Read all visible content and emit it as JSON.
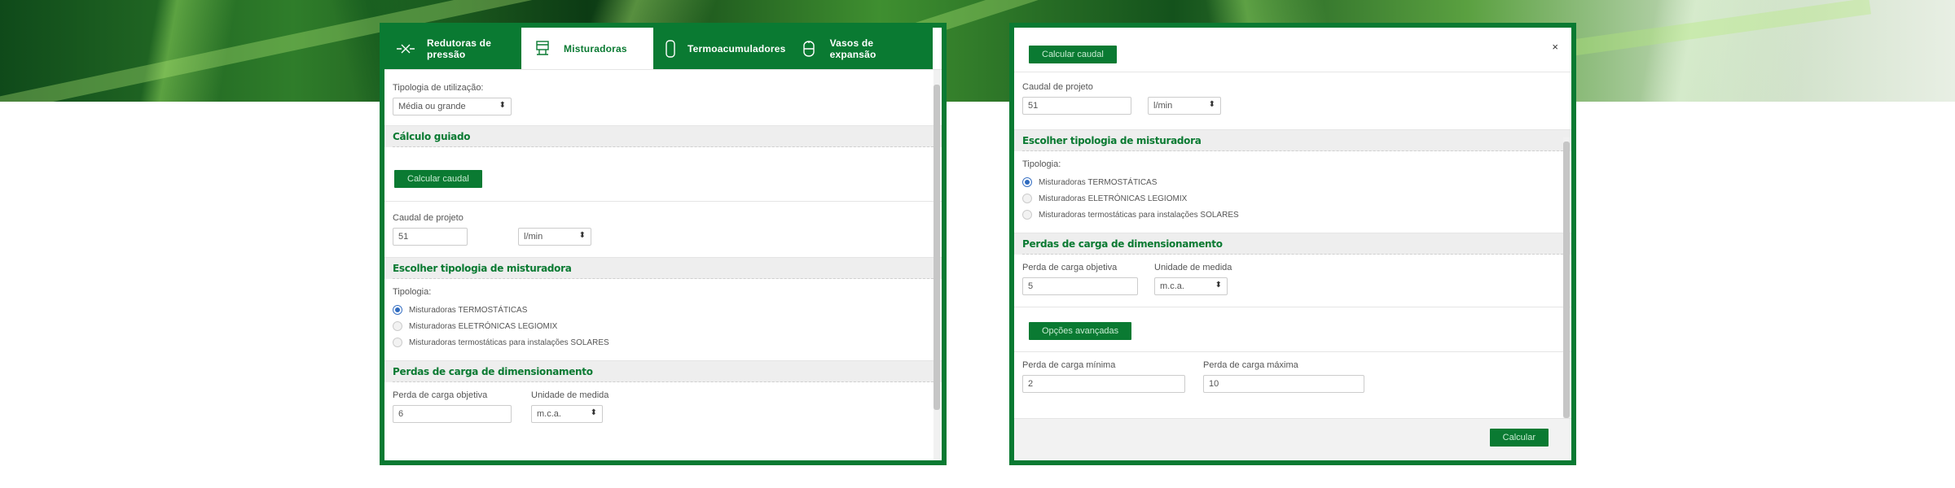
{
  "left_panel": {
    "tabs": [
      {
        "label": "Redutoras de pressão",
        "icon": "pipe-valve-icon"
      },
      {
        "label": "Misturadoras",
        "icon": "mixer-icon"
      },
      {
        "label": "Termoacumuladores",
        "icon": "water-heater-icon"
      },
      {
        "label": "Vasos de expansão",
        "icon": "expansion-vessel-icon"
      }
    ],
    "usage_label": "Tipologia de utilização:",
    "usage_value": "Média ou grande",
    "guided_title": "Cálculo guiado",
    "calc_flow_button": "Calcular caudal",
    "project_flow_label": "Caudal de projeto",
    "project_flow_value": "51",
    "project_flow_unit": "l/min",
    "mixer_title": "Escolher tipologia de misturadora",
    "typology_label": "Tipologia:",
    "options": [
      "Misturadoras TERMOSTÁTICAS",
      "Misturadoras ELETRÓNICAS LEGIOMIX",
      "Misturadoras termostáticas para instalações SOLARES"
    ],
    "losses_title": "Perdas de carga de dimensionamento",
    "target_loss_label": "Perda de carga objetiva",
    "target_loss_value": "6",
    "unit_label": "Unidade de medida",
    "unit_value": "m.c.a."
  },
  "right_panel": {
    "close_glyph": "×",
    "calc_flow_button": "Calcular caudal",
    "project_flow_label": "Caudal de projeto",
    "project_flow_value": "51",
    "project_flow_unit": "l/min",
    "mixer_title": "Escolher tipologia de misturadora",
    "typology_label": "Tipologia:",
    "options": [
      "Misturadoras TERMOSTÁTICAS",
      "Misturadoras ELETRÓNICAS LEGIOMIX",
      "Misturadoras termostáticas para instalações SOLARES"
    ],
    "losses_title": "Perdas de carga de dimensionamento",
    "target_loss_label": "Perda de carga objetiva",
    "target_loss_value": "5",
    "unit_label": "Unidade de medida",
    "unit_value": "m.c.a.",
    "advanced_button": "Opções avançadas",
    "min_loss_label": "Perda de carga mínima",
    "min_loss_value": "2",
    "max_loss_label": "Perda de carga máxima",
    "max_loss_value": "10",
    "calculate_button": "Calcular"
  },
  "colors": {
    "brand_green": "#0a7a32",
    "radio_selected": "#2f6bbf"
  }
}
